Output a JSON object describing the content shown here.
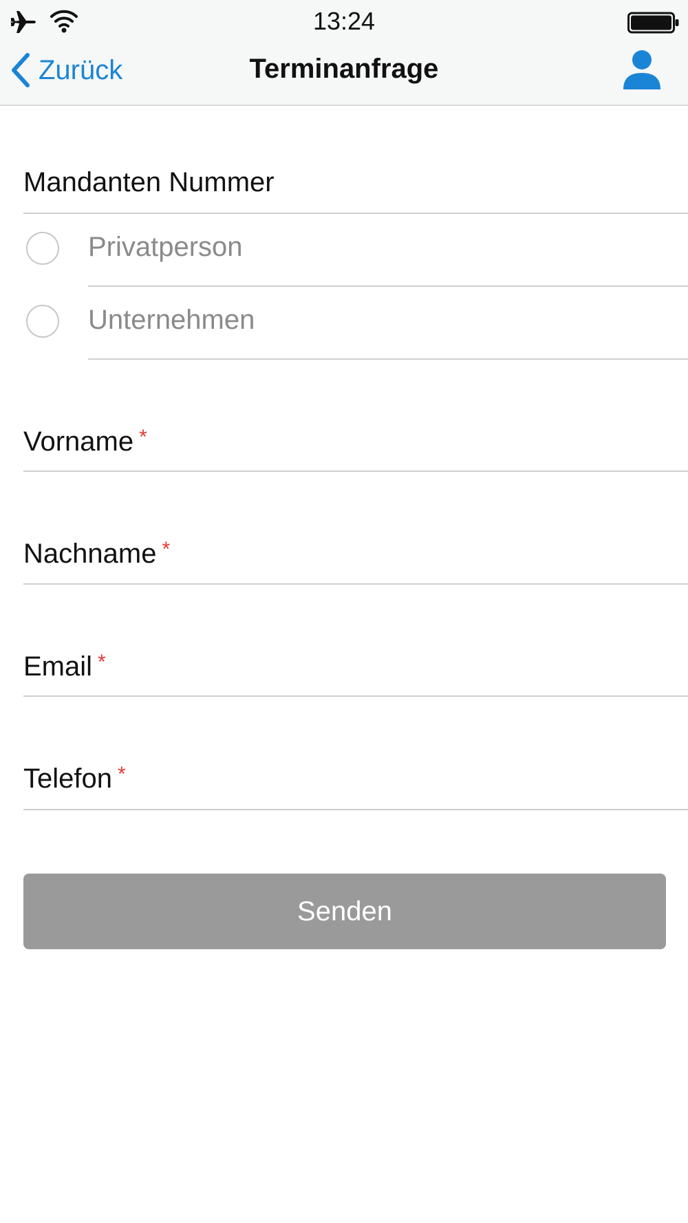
{
  "status_bar": {
    "time": "13:24",
    "icons": [
      "airplane-icon",
      "wifi-icon",
      "battery-icon"
    ]
  },
  "nav": {
    "back_label": "Zurück",
    "title": "Terminanfrage",
    "right_icon": "person-icon"
  },
  "form": {
    "client_number_label": "Mandanten Nummer",
    "client_type_options": [
      {
        "label": "Privatperson",
        "selected": false
      },
      {
        "label": "Unternehmen",
        "selected": false
      }
    ],
    "fields": [
      {
        "label": "Vorname",
        "required_mark": "*"
      },
      {
        "label": "Nachname",
        "required_mark": "*"
      },
      {
        "label": "Email",
        "required_mark": "*"
      },
      {
        "label": "Telefon",
        "required_mark": "*"
      }
    ],
    "submit_label": "Senden"
  },
  "colors": {
    "accent": "#1a85d6",
    "required": "#e53935",
    "button_disabled": "#9a9a9a",
    "header_bg": "#f6f7f7"
  }
}
